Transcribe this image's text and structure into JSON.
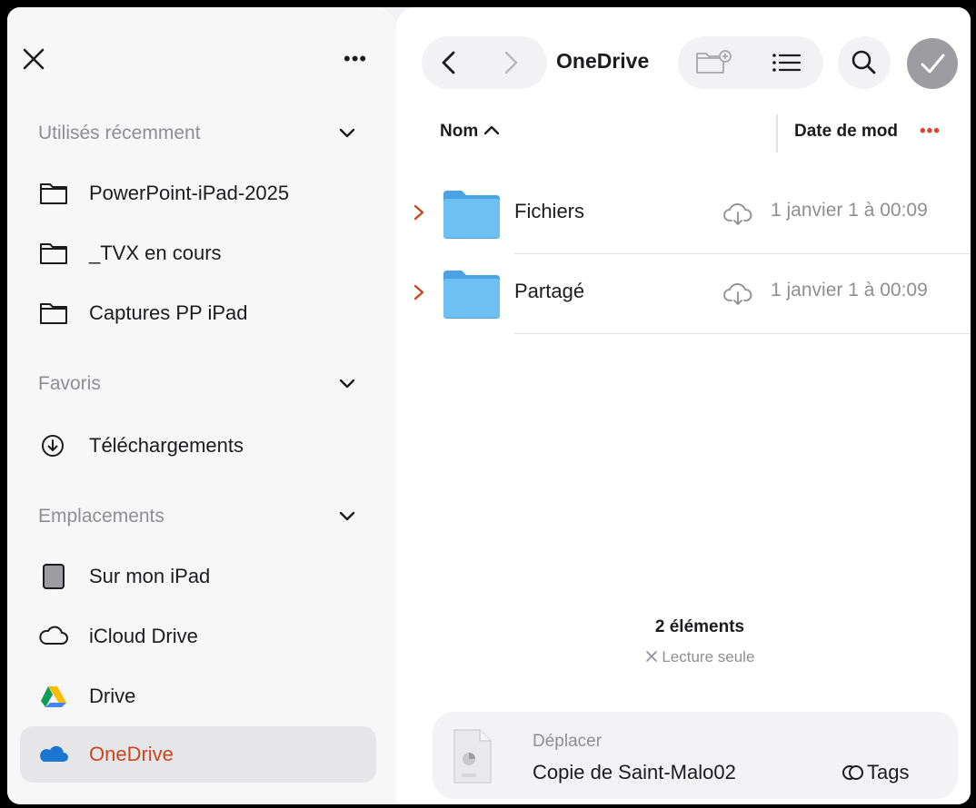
{
  "sidebar": {
    "recent": {
      "title": "Utilisés récemment",
      "items": [
        {
          "label": "PowerPoint-iPad-2025",
          "icon": "folder-icon"
        },
        {
          "label": "_TVX en cours",
          "icon": "folder-icon"
        },
        {
          "label": "Captures PP iPad",
          "icon": "folder-icon"
        }
      ]
    },
    "favorites": {
      "title": "Favoris",
      "items": [
        {
          "label": "Téléchargements",
          "icon": "download-circle-icon"
        }
      ]
    },
    "locations": {
      "title": "Emplacements",
      "items": [
        {
          "label": "Sur mon iPad",
          "icon": "ipad-icon"
        },
        {
          "label": "iCloud Drive",
          "icon": "icloud-icon"
        },
        {
          "label": "Drive",
          "icon": "google-drive-icon"
        },
        {
          "label": "OneDrive",
          "icon": "onedrive-icon",
          "selected": true
        }
      ]
    },
    "more_label": "•••"
  },
  "toolbar": {
    "location_title": "OneDrive"
  },
  "columns": {
    "name": "Nom",
    "date": "Date de mod",
    "more": "•••"
  },
  "files": [
    {
      "name": "Fichiers",
      "date": "1 janvier 1 à 00:09"
    },
    {
      "name": "Partagé",
      "date": "1 janvier 1 à 00:09"
    }
  ],
  "footer": {
    "count": "2 éléments",
    "readonly": "Lecture seule"
  },
  "move_bar": {
    "action": "Déplacer",
    "file_name": "Copie de Saint-Malo02",
    "tags_label": "Tags"
  },
  "colors": {
    "accent": "#c8471f",
    "folder": "#5fb4ea",
    "secondary_text": "#8e8e93"
  }
}
